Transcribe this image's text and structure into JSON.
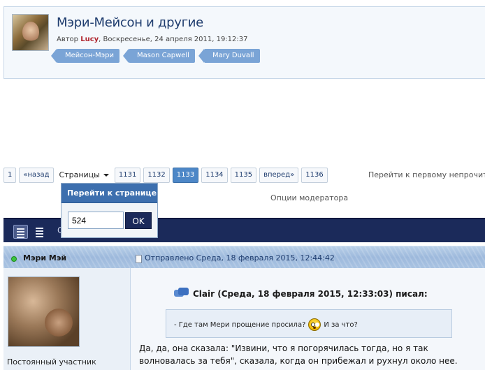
{
  "thread": {
    "title": "Мэри-Мейсон и другие",
    "meta_prefix": "Автор",
    "author": "Lucy",
    "meta_date": ", Воскресенье, 24 апреля 2011, 19:12:37",
    "tags": [
      "Мейсон-Мэри",
      "Mason Capwell",
      "Mary Duvall"
    ]
  },
  "pagination": {
    "first": "1",
    "prev": "«назад",
    "pages_label": "Страницы",
    "pages": [
      "1131",
      "1132",
      "1133",
      "1134",
      "1135"
    ],
    "current": "1133",
    "next": "вперед»",
    "last": "1136",
    "first_unread": "Перейти к первому непрочитанному"
  },
  "moderator_options": "Опции модератора",
  "page_jump": {
    "title": "Перейти к странице",
    "value": "524",
    "button": "OK"
  },
  "toolbar": {
    "label_c": "С"
  },
  "post": {
    "author": "Мэри Мэй",
    "date": "Отправлено Среда, 18 февраля 2015, 12:44:42",
    "rank": "Постоянный участник",
    "quote_author": "Clair (Среда, 18 февраля 2015, 12:33:03) писал:",
    "quote_text_1": "- Где там Мери прощение просила?",
    "quote_text_2": "И за что?",
    "text": "Да, да, она сказала: \"Извини, что я погорячилась тогда, но я так волновалась за тебя\", сказала, когда он прибежал и рухнул около нее."
  },
  "colors": {
    "accent": "#1b2a5a",
    "current_page": "#4d87c7",
    "tag": "#7aa4d6",
    "author_red": "#b0252e",
    "online": "#3ec43e"
  }
}
